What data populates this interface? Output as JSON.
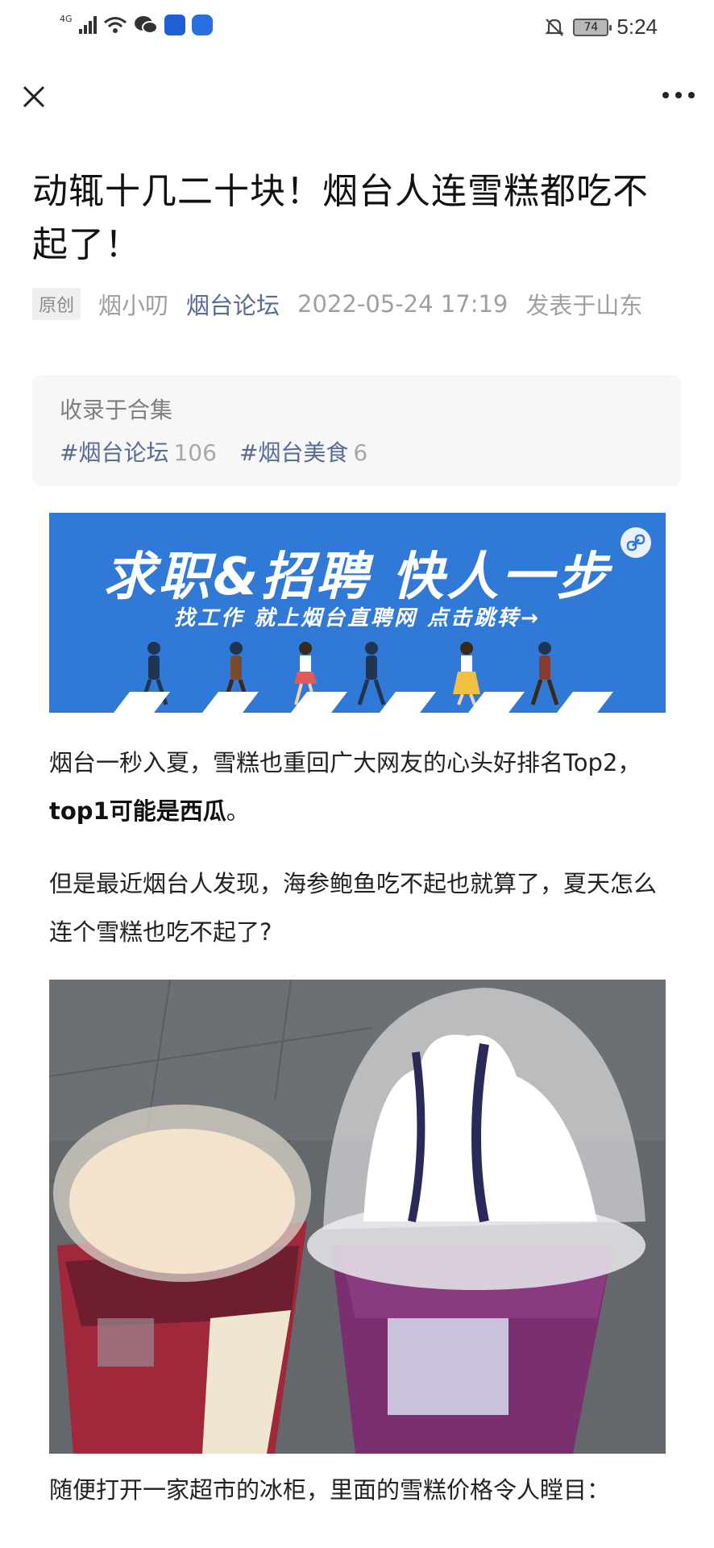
{
  "status_bar": {
    "signal_label": "4G",
    "battery": "74",
    "time": "5:24"
  },
  "article": {
    "title": "动辄十几二十块！烟台人连雪糕都吃不起了！",
    "original_badge": "原创",
    "author": "烟小叨",
    "account": "烟台论坛",
    "date": "2022-05-24 17:19",
    "location": "发表于山东"
  },
  "collection": {
    "label": "收录于合集",
    "tags": [
      {
        "name": "#烟台论坛",
        "count": "106"
      },
      {
        "name": "#烟台美食",
        "count": "6"
      }
    ]
  },
  "banner": {
    "headline": "求职&招聘 快人一步",
    "subline": "找工作 就上烟台直聘网 点击跳转→"
  },
  "paragraphs": {
    "p1_text": "烟台一秒入夏，雪糕也重回广大网友的心头好排名Top2，",
    "p1_bold": "top1可能是西瓜",
    "p1_end": "。",
    "p2_text": "但是最近烟台人发现，海参鲍鱼吃不起也就算了，夏天怎么连个雪糕也吃不起了?",
    "p3_text": "随便打开一家超市的冰柜，里面的雪糕价格令人瞠目："
  },
  "colors": {
    "link_blue": "#576b95",
    "banner_blue": "#3179d6",
    "meta_gray": "#a0a0a0"
  },
  "icons": [
    "close-icon",
    "more-icon",
    "wifi-icon",
    "wechat-icon",
    "bell-off-icon",
    "link-icon"
  ]
}
